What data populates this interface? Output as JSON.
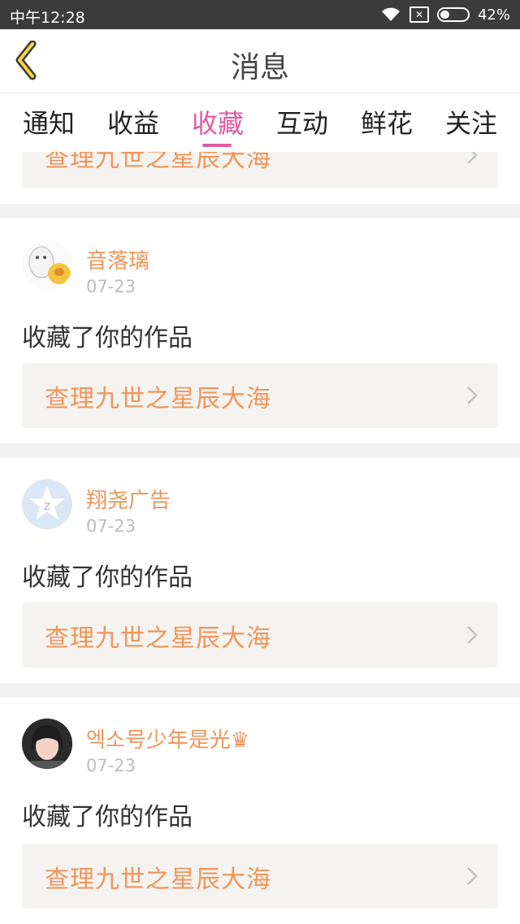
{
  "status": {
    "time": "中午12:28",
    "battery_pct": "42%"
  },
  "header": {
    "title": "消息"
  },
  "tabs": [
    {
      "label": "通知"
    },
    {
      "label": "收益"
    },
    {
      "label": "收藏"
    },
    {
      "label": "互动"
    },
    {
      "label": "鲜花"
    },
    {
      "label": "关注"
    }
  ],
  "active_tab": "收藏",
  "top_card": {
    "work_title": "查理九世之星辰大海"
  },
  "items": [
    {
      "user": "音落璃",
      "date": "07-23",
      "action": "收藏了你的作品",
      "work_title": "查理九世之星辰大海"
    },
    {
      "user": "翔尧广告",
      "date": "07-23",
      "action": "收藏了你的作品",
      "work_title": "查理九世之星辰大海"
    },
    {
      "user": "엑소号少年是光♛",
      "date": "07-23",
      "action": "收藏了你的作品",
      "work_title": "查理九世之星辰大海"
    }
  ],
  "colors": {
    "accent": "#e05aa2",
    "work_text": "#f0955a",
    "username": "#f0955a"
  }
}
